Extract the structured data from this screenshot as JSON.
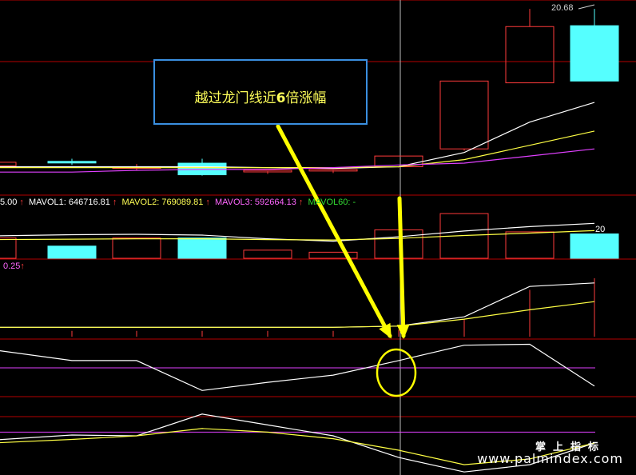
{
  "annotation": {
    "text_before": "越过龙门线近",
    "text_bold": "6",
    "text_after": "倍涨幅"
  },
  "price_label": "20.68",
  "volume_label": "20",
  "mavol": {
    "prefix": "5.00",
    "mavol1": "MAVOL1: 646716.81",
    "mavol2": "MAVOL2: 769089.81",
    "mavol3": "MAVOL3: 592664.13",
    "mavol60": "MAVOL60: -",
    "colors": {
      "mavol1": "#ffffff",
      "mavol2": "#ffff55",
      "mavol3": "#ff66ff",
      "mavol60": "#33dd33",
      "arrow": "#ff3b3b"
    }
  },
  "panel3_label": "0.25",
  "watermark": {
    "cn": "掌上指标",
    "url": "www.palmindex.com"
  },
  "colors": {
    "up": "#ff3b3b",
    "down": "#55ffff",
    "grid": "#b40000",
    "ma_white": "#ffffff",
    "ma_yellow": "#ffff44",
    "ma_purple": "#e040ff",
    "annotation": "#ffff00"
  },
  "chart_data": [
    {
      "type": "candlestick",
      "panel": "price",
      "candles": [
        {
          "o": 3.5,
          "h": 3.6,
          "l": 2.8,
          "c": 3.1,
          "dir": "up"
        },
        {
          "o": 3.6,
          "h": 3.9,
          "l": 3.2,
          "c": 3.55,
          "dir": "down"
        },
        {
          "o": 2.9,
          "h": 3.3,
          "l": 2.6,
          "c": 3.0,
          "dir": "up"
        },
        {
          "o": 3.4,
          "h": 3.9,
          "l": 2.0,
          "c": 2.1,
          "dir": "down"
        },
        {
          "o": 2.5,
          "h": 2.7,
          "l": 2.2,
          "c": 2.6,
          "dir": "up"
        },
        {
          "o": 2.6,
          "h": 2.8,
          "l": 2.3,
          "c": 2.7,
          "dir": "up"
        },
        {
          "o": 3.0,
          "h": 4.2,
          "l": 2.9,
          "c": 4.2,
          "dir": "up"
        },
        {
          "o": 5.0,
          "h": 12.6,
          "l": 4.8,
          "c": 12.6,
          "dir": "up"
        },
        {
          "o": 12.4,
          "h": 20.68,
          "l": 12.4,
          "c": 18.7,
          "dir": "up"
        },
        {
          "o": 18.8,
          "h": 20.68,
          "l": 12.6,
          "c": 12.6,
          "dir": "down"
        }
      ],
      "ma_white": [
        3.0,
        3.0,
        3.0,
        3.0,
        2.9,
        2.8,
        3.0,
        4.6,
        8.0,
        10.2
      ],
      "ma_yellow": [
        2.9,
        2.9,
        2.9,
        2.9,
        2.9,
        2.9,
        3.0,
        3.8,
        5.4,
        7.0
      ],
      "ma_purple": [
        2.4,
        2.4,
        2.6,
        2.7,
        2.7,
        2.9,
        3.2,
        3.4,
        4.2,
        5.0
      ]
    },
    {
      "type": "bar",
      "panel": "volume",
      "bars": [
        {
          "v": 5,
          "dir": "up"
        },
        {
          "v": 3,
          "dir": "down"
        },
        {
          "v": 5,
          "dir": "up"
        },
        {
          "v": 5,
          "dir": "down"
        },
        {
          "v": 2,
          "dir": "up"
        },
        {
          "v": 1.5,
          "dir": "up"
        },
        {
          "v": 7,
          "dir": "up"
        },
        {
          "v": 11,
          "dir": "up"
        },
        {
          "v": 6.5,
          "dir": "up"
        },
        {
          "v": 6,
          "dir": "down"
        }
      ],
      "ma_white": [
        5.5,
        5.8,
        5.9,
        5.7,
        4.8,
        4.2,
        5.3,
        6.7,
        7.8,
        8.6
      ],
      "ma_yellow": [
        4.6,
        4.7,
        4.8,
        4.8,
        4.6,
        4.5,
        4.9,
        5.6,
        6.2,
        6.8
      ]
    },
    {
      "type": "line",
      "panel": "indicator_1",
      "stems": [
        0.5,
        0.5,
        0.5,
        0.5,
        0.5,
        0.5,
        0.6,
        1.5,
        4.0,
        5.0
      ],
      "white": [
        0.8,
        0.8,
        0.8,
        0.8,
        0.8,
        0.8,
        0.9,
        1.7,
        4.3,
        4.6
      ],
      "yellow": [
        0.8,
        0.8,
        0.8,
        0.8,
        0.8,
        0.8,
        0.9,
        1.5,
        2.3,
        3.0
      ]
    },
    {
      "type": "line",
      "panel": "indicator_2",
      "white": [
        2.0,
        0.8,
        0.8,
        -2.5,
        -1.6,
        -0.8,
        0.8,
        2.5,
        2.6,
        -2.0
      ],
      "purple_level": 0.0
    },
    {
      "type": "line",
      "panel": "indicator_3",
      "white": [
        -0.6,
        0.1,
        0.0,
        3.0,
        1.5,
        0.0,
        -3.0,
        -5.0,
        -4.0,
        -1.0
      ],
      "yellow": [
        -1.0,
        -0.5,
        0.0,
        1.0,
        0.5,
        -0.4,
        -2.0,
        -4.0,
        -3.2,
        -1.0
      ],
      "purple_level": 0.5
    }
  ]
}
